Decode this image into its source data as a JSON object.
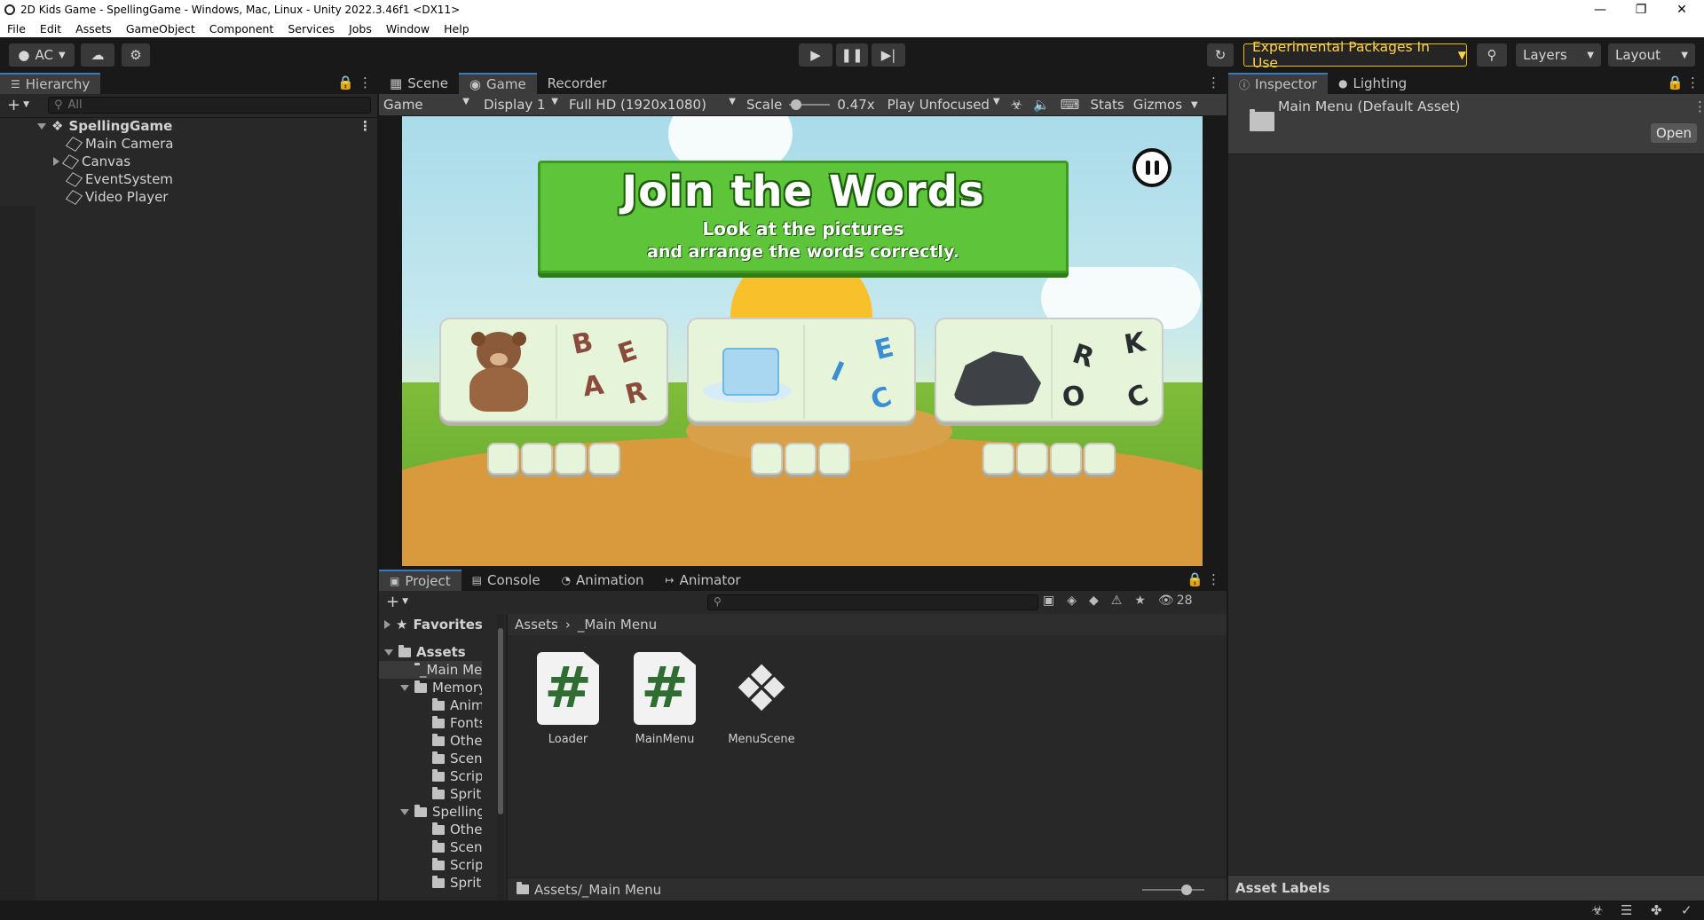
{
  "window": {
    "title": "2D Kids Game - SpellingGame - Windows, Mac, Linux - Unity 2022.3.46f1 <DX11>"
  },
  "menu": [
    "File",
    "Edit",
    "Assets",
    "GameObject",
    "Component",
    "Services",
    "Jobs",
    "Window",
    "Help"
  ],
  "toolbar": {
    "account": "AC",
    "experimental": "Experimental Packages In Use",
    "layers": "Layers",
    "layout": "Layout"
  },
  "hierarchy": {
    "tab": "Hierarchy",
    "search_placeholder": "All",
    "scene": "SpellingGame",
    "items": [
      "Main Camera",
      "Canvas",
      "EventSystem",
      "Video Player"
    ]
  },
  "game": {
    "tabs": [
      "Scene",
      "Game",
      "Recorder"
    ],
    "mode": "Game",
    "display": "Display 1",
    "resolution": "Full HD (1920x1080)",
    "scale_label": "Scale",
    "scale_value": "0.47x",
    "play_mode": "Play Unfocused",
    "stats": "Stats",
    "gizmos": "Gizmos",
    "banner_title": "Join the Words",
    "banner_line1": "Look at the pictures",
    "banner_line2": "and arrange the words correctly.",
    "cards": [
      {
        "picture": "bear",
        "letters": [
          "B",
          "E",
          "A",
          "R"
        ]
      },
      {
        "picture": "ice",
        "letters": [
          "I",
          "E",
          "C"
        ]
      },
      {
        "picture": "rock",
        "letters": [
          "R",
          "K",
          "O",
          "C"
        ]
      }
    ],
    "slots": [
      4,
      3,
      4
    ]
  },
  "inspector": {
    "tabs": [
      "Inspector",
      "Lighting"
    ],
    "title": "Main Menu (Default Asset)",
    "open": "Open",
    "asset_labels": "Asset Labels"
  },
  "project": {
    "tabs": [
      "Project",
      "Console",
      "Animation",
      "Animator"
    ],
    "count": "28",
    "favorites": "Favorites",
    "assets_root": "Assets",
    "tree": [
      {
        "label": "_Main Me",
        "depth": 1,
        "open": false
      },
      {
        "label": "Memory C",
        "depth": 1,
        "open": true
      },
      {
        "label": "Animati",
        "depth": 2
      },
      {
        "label": "Fonts",
        "depth": 2
      },
      {
        "label": "Other",
        "depth": 2
      },
      {
        "label": "Scenes",
        "depth": 2
      },
      {
        "label": "Scripts",
        "depth": 2
      },
      {
        "label": "Sprites",
        "depth": 2
      },
      {
        "label": "Spelling C",
        "depth": 1,
        "open": true
      },
      {
        "label": "Other",
        "depth": 2
      },
      {
        "label": "Scenes",
        "depth": 2
      },
      {
        "label": "Scripts",
        "depth": 2
      },
      {
        "label": "Sprites",
        "depth": 2
      }
    ],
    "breadcrumb": [
      "Assets",
      "_Main Menu"
    ],
    "assets": [
      {
        "name": "Loader",
        "icon": "script-icon"
      },
      {
        "name": "MainMenu",
        "icon": "script-icon"
      },
      {
        "name": "MenuScene",
        "icon": "unity-scene-icon"
      }
    ],
    "path": "Assets/_Main Menu"
  }
}
